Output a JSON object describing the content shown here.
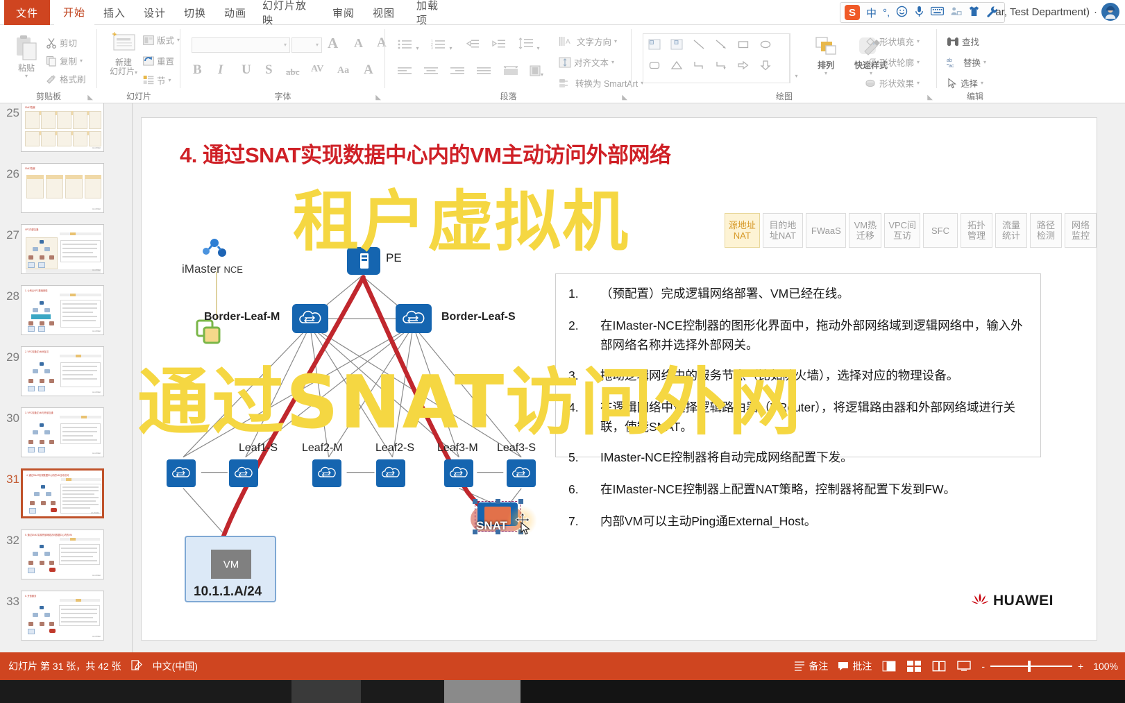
{
  "app": {
    "title_fragment": "ar, Test Department) ",
    "title_caret": "·"
  },
  "ime": {
    "logo": "S",
    "items": [
      "中",
      "°,",
      "☺",
      "🎤",
      "⌨",
      "👥",
      "👕",
      "🔧"
    ],
    "names": [
      "sogou-logo",
      "chinese-mode",
      "punctuation-mode",
      "emoji-picker",
      "voice-input",
      "soft-keyboard",
      "user-dict",
      "skin",
      "settings"
    ]
  },
  "ribbon": {
    "file_tab": "文件",
    "tabs": [
      "开始",
      "插入",
      "设计",
      "切换",
      "动画",
      "幻灯片放映",
      "审阅",
      "视图",
      "加载项"
    ],
    "active_tab": "开始",
    "groups": {
      "clipboard": {
        "label": "剪贴板",
        "paste": "粘贴",
        "cut": "剪切",
        "copy": "复制",
        "format_painter": "格式刷"
      },
      "slides": {
        "label": "幻灯片",
        "new_slide_line1": "新建",
        "new_slide_line2": "幻灯片",
        "layout": "版式",
        "reset": "重置",
        "section": "节"
      },
      "font": {
        "label": "字体",
        "font_name": "",
        "font_size": "",
        "grow": "A",
        "shrink": "A",
        "clear_formatting": "A",
        "bold": "B",
        "italic": "I",
        "underline": "U",
        "shadow": "S",
        "strikethrough": "abc",
        "spacing": "AV",
        "change_case": "Aa",
        "font_color": "A"
      },
      "paragraph": {
        "label": "段落",
        "text_direction": "文字方向",
        "align_text": "对齐文本",
        "convert_smartart": "转换为 SmartArt"
      },
      "drawing": {
        "label": "绘图",
        "arrange": "排列",
        "quick_styles": "快速样式",
        "shape_fill": "形状填充",
        "shape_outline": "形状轮廓",
        "shape_effects": "形状效果"
      },
      "editing": {
        "label": "编辑",
        "find": "查找",
        "replace": "替换",
        "select": "选择"
      }
    }
  },
  "thumbnails": {
    "selected": 31,
    "slides": [
      25,
      26,
      27,
      28,
      29,
      30,
      31,
      32,
      33
    ]
  },
  "slide": {
    "title": "4. 通过SNAT实现数据中心内的VM主动访问外部网络",
    "chips": [
      {
        "label": "源地址NAT",
        "active": true
      },
      {
        "label": "目的地址NAT",
        "active": false
      },
      {
        "label": "FWaaS",
        "active": false
      },
      {
        "label": "VM热迁移",
        "active": false
      },
      {
        "label": "VPC间互访",
        "active": false
      },
      {
        "label": "SFC",
        "active": false
      },
      {
        "label": "拓扑管理",
        "active": false
      },
      {
        "label": "流量统计",
        "active": false
      },
      {
        "label": "路径检测",
        "active": false
      },
      {
        "label": "网络监控",
        "active": false
      }
    ],
    "diagram": {
      "controller": "iMaster",
      "controller_sub": "NCE",
      "pe": "PE",
      "border_leaf_m": "Border-Leaf-M",
      "border_leaf_s": "Border-Leaf-S",
      "leaves": [
        "Leaf1-S",
        "Leaf2-M",
        "Leaf2-S",
        "Leaf3-M",
        "Leaf3-S"
      ],
      "vm_label": "VM",
      "vm_subnet": "10.1.1.A/24",
      "snat_label": "SNAT"
    },
    "steps": [
      {
        "num": "1.",
        "text": "（预配置）完成逻辑网络部署、VM已经在线。"
      },
      {
        "num": "2.",
        "text": "在IMaster-NCE控制器的图形化界面中，拖动外部网络域到逻辑网络中，输入外部网络名称并选择外部网关。"
      },
      {
        "num": "3.",
        "text": "拖动逻辑网络中的服务节点（比如防火墙），选择对应的物理设备。"
      },
      {
        "num": "4.",
        "text": "在逻辑网络中选择逻辑路由器（VRouter），将逻辑路由器和外部网络域进行关联，使能SNAT。"
      },
      {
        "num": "5.",
        "text": "IMaster-NCE控制器将自动完成网络配置下发。"
      },
      {
        "num": "6.",
        "text": "在IMaster-NCE控制器上配置NAT策略，控制器将配置下发到FW。"
      },
      {
        "num": "7.",
        "text": "内部VM可以主动Ping通External_Host。"
      }
    ],
    "brand": "HUAWEI"
  },
  "overlay_caption": {
    "line1": "租户虚拟机",
    "line2": "通过SNAT访问外网"
  },
  "statusbar": {
    "slide_count": "幻灯片 第 31 张，共 42 张",
    "language": "中文(中国)",
    "notes": "备注",
    "comments": "批注",
    "zoom_value": "100%",
    "zoom_minus": "-",
    "zoom_plus": "+"
  },
  "colors": {
    "accent": "#cf4520",
    "title_red": "#cf2026",
    "chip_active_bg": "#fdf3d4",
    "chip_active_text": "#d79a2b",
    "node_blue": "#1565b0",
    "caption_yellow": "#f5d742",
    "path_red": "#c0272d",
    "selection_orange": "#c0522a"
  }
}
